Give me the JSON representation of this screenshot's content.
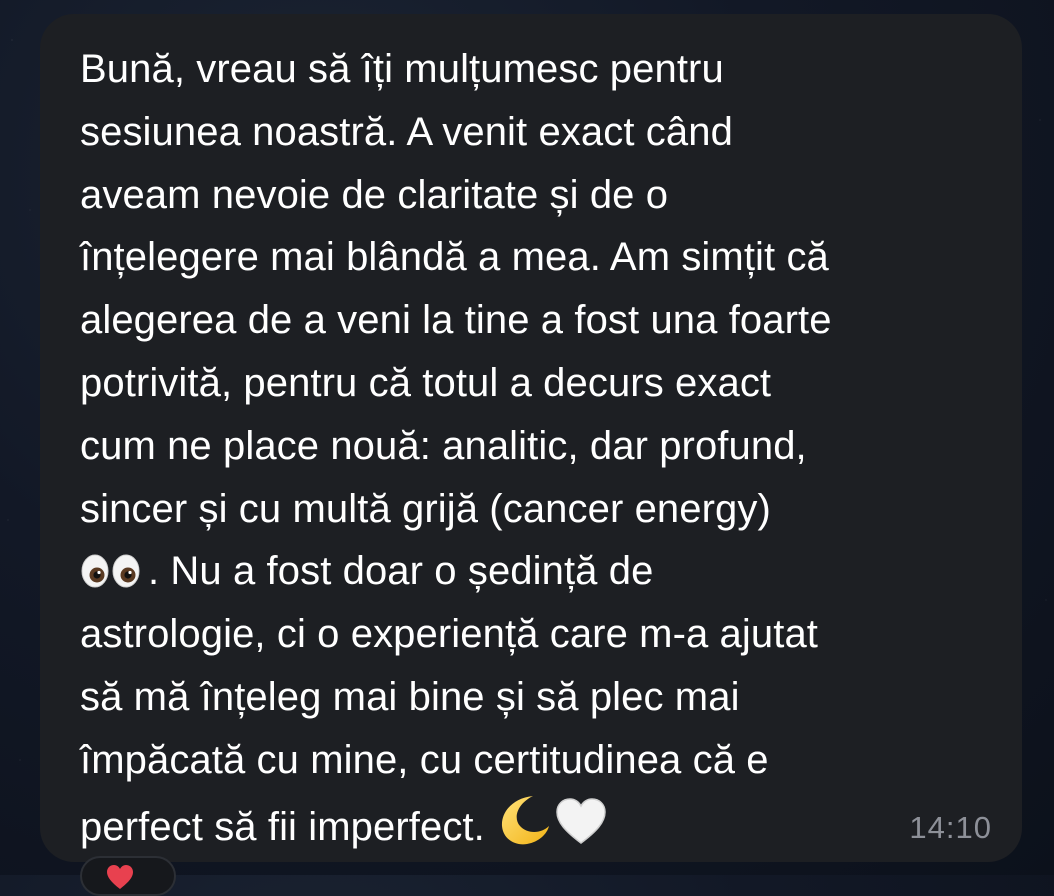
{
  "message": {
    "lines": [
      "Bună, vreau să îți mulțumesc pentru",
      "sesiunea noastră. A venit exact când",
      "aveam nevoie de claritate și de o",
      "înțelegere mai blândă a mea. Am simțit că",
      "alegerea de a veni la tine a fost una foarte",
      "potrivită, pentru că totul a decurs exact",
      "cum ne place nouă: analitic, dar profund,",
      "sincer și cu multă grijă (cancer energy)",
      ". Nu a fost doar o ședință de",
      "astrologie, ci o experiență care m-a ajutat",
      "să mă înțeleg mai bine și să plec mai",
      "împăcată cu mine, cu certitudinea că e",
      "perfect să fii imperfect."
    ],
    "emojis": {
      "eyes": "eyes-emoji",
      "moon": "crescent-moon-emoji",
      "heart": "white-heart-emoji"
    },
    "time": "14:10"
  },
  "reaction": {
    "icon": "red-heart-icon"
  },
  "colors": {
    "bubble": "#1d1f23",
    "text": "#ffffff",
    "timestamp": "#8d9098",
    "background": "#121826"
  }
}
